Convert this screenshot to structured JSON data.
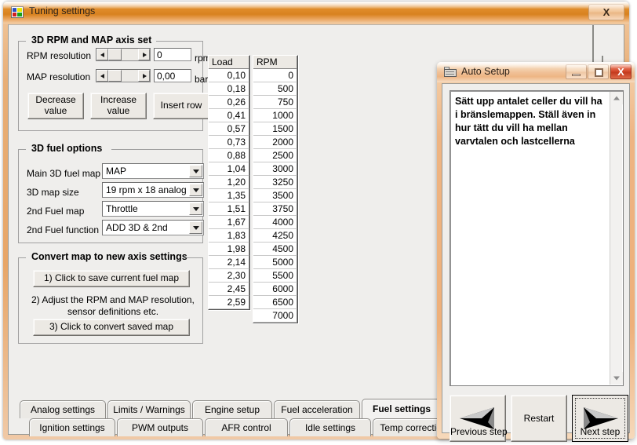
{
  "main_window": {
    "title": "Tuning settings",
    "icon": "app-icon",
    "close_label": "X"
  },
  "axis_group": {
    "legend": "3D RPM and MAP axis set",
    "rpm_resolution": {
      "label": "RPM resolution",
      "value": "0",
      "unit": "rpm"
    },
    "map_resolution": {
      "label": "MAP resolution",
      "value": "0,00",
      "unit": "bar"
    },
    "buttons": [
      {
        "line1": "Decrease",
        "line2": "value"
      },
      {
        "line1": "Increase",
        "line2": "value"
      },
      {
        "line1": "Insert row",
        "line2": ""
      }
    ]
  },
  "fuel_group": {
    "legend": "3D fuel options",
    "fields": [
      {
        "label": "Main 3D fuel map",
        "value": "MAP"
      },
      {
        "label": "3D map size",
        "value": "19 rpm x 18 analog"
      },
      {
        "label": "2nd Fuel map",
        "value": "Throttle"
      },
      {
        "label": "2nd Fuel function",
        "value": "ADD 3D & 2nd"
      }
    ]
  },
  "convert_group": {
    "legend": "Convert map to new axis settings",
    "step1_button": "1) Click to save current fuel map",
    "step2_line1": "2) Adjust the RPM and MAP resolution,",
    "step2_line2": "sensor definitions etc.",
    "step3_button": "3) Click to convert saved map"
  },
  "load_grid": {
    "header": "Load",
    "values": [
      "0,10",
      "0,18",
      "0,26",
      "0,41",
      "0,57",
      "0,73",
      "0,88",
      "1,04",
      "1,20",
      "1,35",
      "1,51",
      "1,67",
      "1,83",
      "1,98",
      "2,14",
      "2,30",
      "2,45",
      "2,59"
    ]
  },
  "rpm_grid": {
    "header": "RPM",
    "values": [
      "0",
      "500",
      "750",
      "1000",
      "1500",
      "2000",
      "2500",
      "3000",
      "3250",
      "3500",
      "3750",
      "4000",
      "4250",
      "4500",
      "5000",
      "5500",
      "6000",
      "6500",
      "7000"
    ]
  },
  "tabs": {
    "row1": [
      {
        "label": "Analog settings",
        "selected": false
      },
      {
        "label": "Limits / Warnings",
        "selected": false
      },
      {
        "label": "Engine setup",
        "selected": false
      },
      {
        "label": "Fuel acceleration",
        "selected": false
      },
      {
        "label": "Fuel settings",
        "selected": true
      },
      {
        "label": "",
        "selected": false
      }
    ],
    "row2": [
      {
        "label": "Ignition settings",
        "selected": false
      },
      {
        "label": "PWM outputs",
        "selected": false
      },
      {
        "label": "AFR control",
        "selected": false
      },
      {
        "label": "Idle settings",
        "selected": false
      },
      {
        "label": "Temp corrections",
        "selected": false
      }
    ]
  },
  "auto_setup": {
    "title": "Auto Setup",
    "icon": "folder-icon",
    "minimize_label": "",
    "maximize_label": "",
    "close_label": "X",
    "message": "Sätt upp antalet celler du vill ha i bränslemappen. Ställ även in hur tätt du vill ha mellan varvtalen och lastcellerna",
    "buttons": {
      "previous": "Previous step",
      "restart": "Restart",
      "next": "Next step"
    }
  },
  "colors": {
    "title_accent": "#e08c2a",
    "frame": "#eeb07a",
    "close_red": "#d4482a",
    "face": "#efeeec"
  }
}
